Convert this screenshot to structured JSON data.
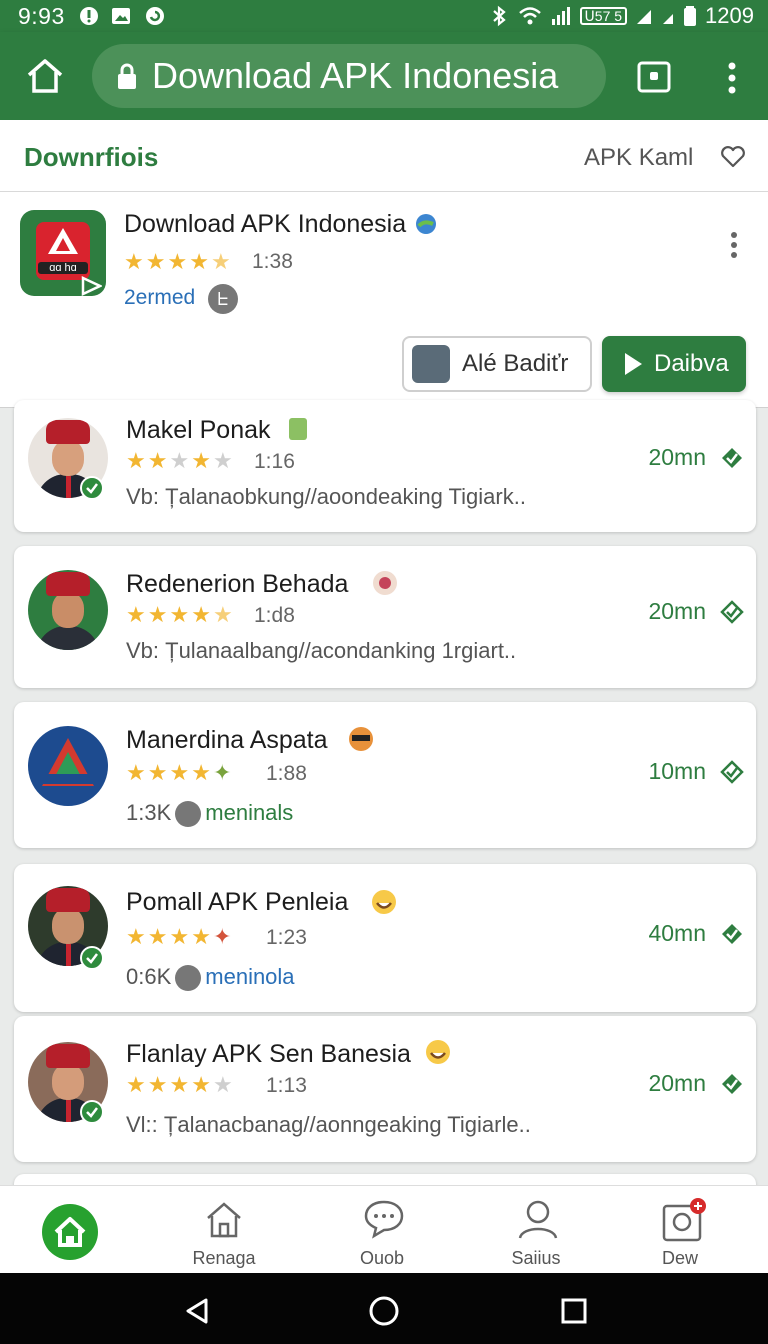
{
  "status": {
    "time": "9:93",
    "battery_text": "ᑌ57 5",
    "clock_right": "1209"
  },
  "toolbar": {
    "url_title": "Download APK Indonesia"
  },
  "subheader": {
    "title": "Downrfiois",
    "right_text": "APK Kaml"
  },
  "featured": {
    "title": "Download APK Indonesia",
    "icon_text": "ɑɑ hɑ",
    "rating": "1:38",
    "stars": 4.5,
    "link_text": "2ermed",
    "link_badge": "ᖶ",
    "btn_secondary": "Alé Badiťr",
    "btn_primary": "Daibva"
  },
  "items": [
    {
      "name": "Makel Ponak",
      "rating": "1:16",
      "stars": 3.5,
      "meta": "Vb: Țalanaobkung//aoondeaking Tigiark..",
      "duration": "20mn",
      "verified": true
    },
    {
      "name": "Redenerion Behada",
      "rating": "1:d8",
      "stars": 4.5,
      "meta": "Vb: Țulanaalbang//acondanking 1rgiart..",
      "duration": "20mn",
      "verified": false
    },
    {
      "name": "Manerdina Aspata",
      "rating": "1:88",
      "stars": 4,
      "meta_count": "1:3K",
      "meta_link": "meninals",
      "duration": "10mn",
      "verified": false
    },
    {
      "name": "Pomall APK Penleia",
      "rating": "1:23",
      "stars": 4,
      "meta_count": "0:6K",
      "meta_link": "meninola",
      "duration": "40mn",
      "verified": true
    },
    {
      "name": "Flanlay APK Sen Banesia",
      "rating": "1:13",
      "stars": 4,
      "meta": "Vl:: Țalanacbanag//aonngeaking Tigiarle..",
      "duration": "20mn",
      "verified": true
    }
  ],
  "nav": {
    "home": "",
    "tab2": "Renaga",
    "tab3": "Ouob",
    "tab4": "Saiius",
    "tab5": "Dew"
  },
  "colors": {
    "brand": "#2e7d40",
    "star": "#f2b632",
    "nav_active": "#27a12f"
  }
}
